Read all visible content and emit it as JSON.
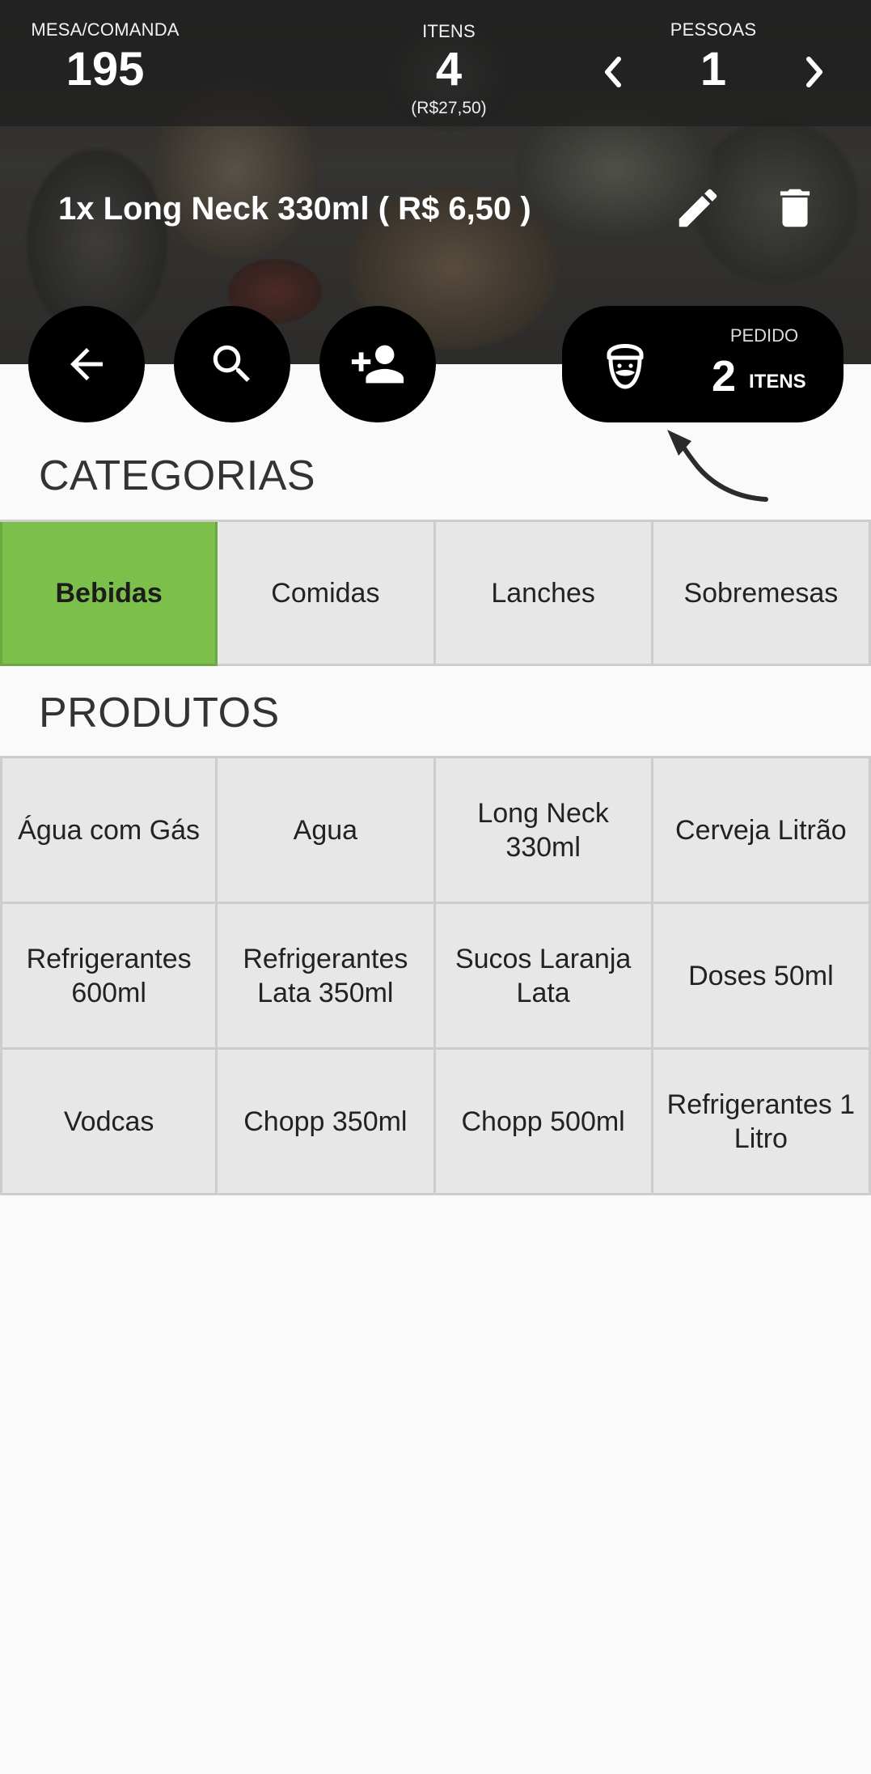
{
  "header": {
    "mesa_label": "MESA/COMANDA",
    "mesa_value": "195",
    "itens_label": "ITENS",
    "itens_value": "4",
    "itens_total": "(R$27,50)",
    "pessoas_label": "PESSOAS",
    "pessoas_value": "1"
  },
  "selected_item": "1x Long Neck 330ml  ( R$ 6,50 )",
  "actions": {
    "edit_icon": "pencil-icon",
    "delete_icon": "trash-icon",
    "back_icon": "arrow-left-icon",
    "search_icon": "search-icon",
    "add_person_icon": "person-add-icon"
  },
  "pedido": {
    "label": "PEDIDO",
    "count": "2",
    "unit": "ITENS",
    "icon": "waiter-icon"
  },
  "categories_title": "CATEGORIAS",
  "categories": [
    {
      "label": "Bebidas",
      "active": true
    },
    {
      "label": "Comidas",
      "active": false
    },
    {
      "label": "Lanches",
      "active": false
    },
    {
      "label": "Sobremesas",
      "active": false
    }
  ],
  "products_title": "PRODUTOS",
  "products": [
    "Água com Gás",
    "Agua",
    "Long Neck 330ml",
    "Cerveja Litrão",
    "Refrigerantes 600ml",
    "Refrigerantes Lata 350ml",
    "Sucos Laranja Lata",
    "Doses 50ml",
    "Vodcas",
    "Chopp 350ml",
    "Chopp 500ml",
    "Refrigerantes 1 Litro"
  ],
  "colors": {
    "active_category": "#7cc04b",
    "button_bg": "#000000",
    "cell_bg": "#e7e7e7"
  }
}
